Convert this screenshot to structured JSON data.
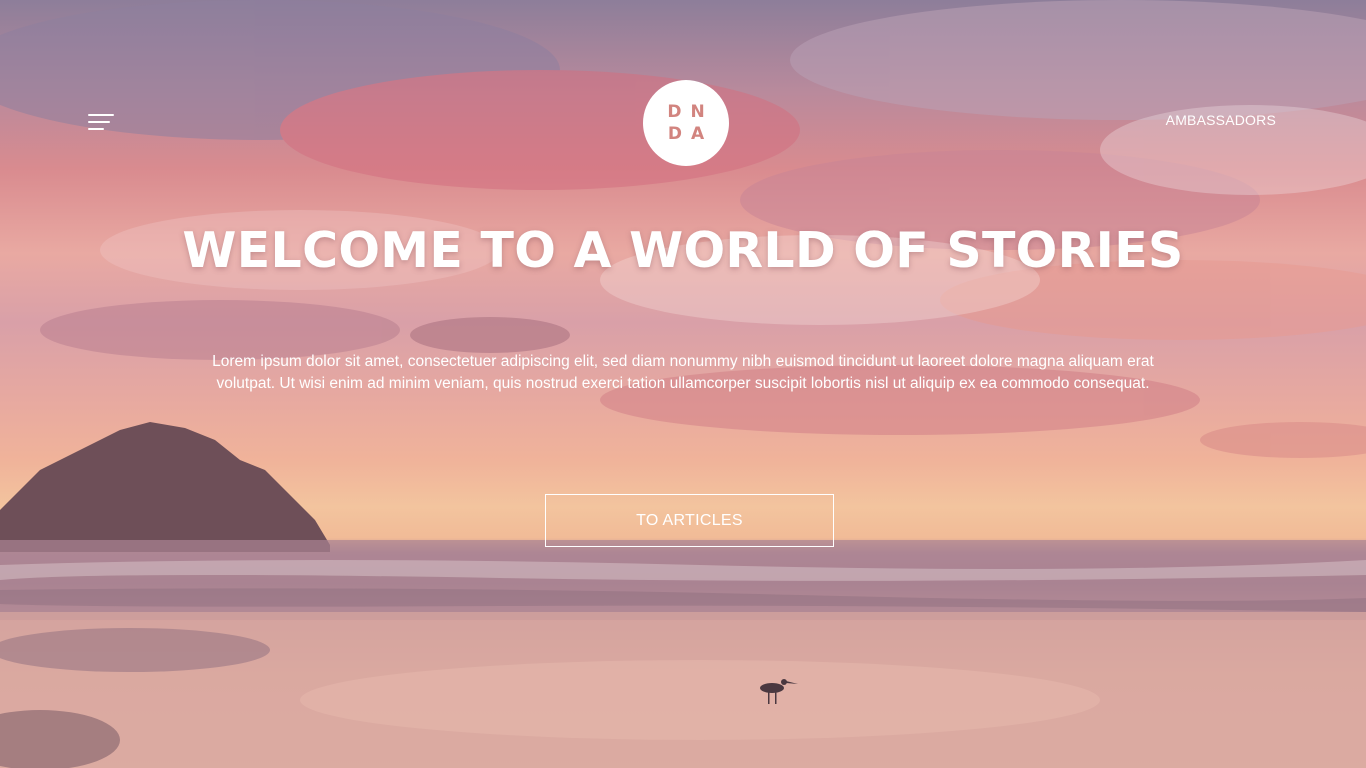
{
  "header": {
    "logo_line1": "DN",
    "logo_line2": "DA",
    "nav_link": "AMBASSADORS"
  },
  "hero": {
    "title": "WELCOME TO A WORLD OF STORIES",
    "lead": "Lorem ipsum dolor sit amet, consectetuer adipiscing elit, sed diam nonummy nibh euismod tincidunt ut laoreet dolore magna aliquam erat volutpat. Ut wisi enim ad minim veniam, quis nostrud exerci tation ullamcorper suscipit lobortis nisl ut aliquip ex ea commodo consequat.",
    "cta_label": "TO ARTICLES"
  },
  "icons": {
    "menu": "hamburger-menu-icon"
  },
  "colors": {
    "logo_text": "#d2847f",
    "text": "#ffffff",
    "sky_top": "#8d7e9a",
    "sky_pink": "#d98b8f",
    "horizon": "#f3c49e",
    "rock": "#6e4f58"
  }
}
